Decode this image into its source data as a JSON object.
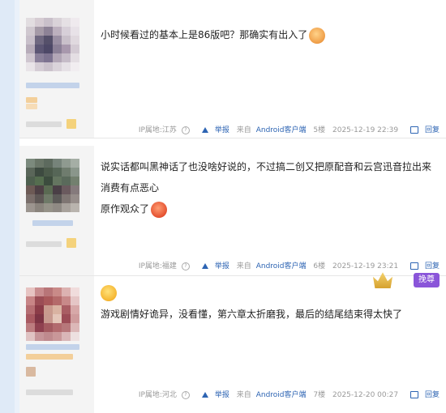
{
  "posts": [
    {
      "text_lines": [
        "小时候看过的基本上是86版吧？那确实有出入了"
      ],
      "emoji": "sad-face-emoji",
      "ip_label": "IP属地:江苏",
      "report": "举报",
      "source": "来自Android客户端",
      "floor": "5楼",
      "time": "2025-12-19 22:39",
      "reply": "回复"
    },
    {
      "text_lines": [
        "说实话都叫黑神话了也没啥好说的，不过搞二创又把原配音和云宫迅音拉出来消费有点恶心",
        "原作观众了"
      ],
      "emoji": "angry-face-emoji",
      "ip_label": "IP属地:福建",
      "report": "举报",
      "source": "来自Android客户端",
      "floor": "6楼",
      "time": "2025-12-19 23:21",
      "reply": "回复"
    },
    {
      "text_lines": [
        "游戏剧情好诡异，没看懂，第六章太折磨我，最后的结尾结束得太快了"
      ],
      "emoji": "smile-face-emoji",
      "badge": "挽尊",
      "ip_label": "IP属地:河北",
      "report": "举报",
      "source": "来自Android客户端",
      "floor": "7楼",
      "time": "2025-12-20 00:27",
      "reply": "回复"
    }
  ]
}
